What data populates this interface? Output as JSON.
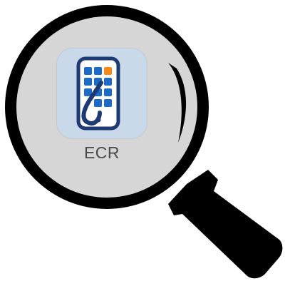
{
  "app": {
    "label": "ECR",
    "icon_name": "phone-app-grid-icon",
    "icon_background": "#c9d9ea",
    "icon_outline_color": "#1d3a74",
    "tile_color_primary": "#1e6ac7",
    "tile_color_accent": "#f48a1c"
  },
  "magnifier": {
    "icon_name": "magnifying-glass-icon",
    "rim_color": "#000000",
    "lens_color": "#d6d6d6",
    "handle_color": "#000000"
  }
}
